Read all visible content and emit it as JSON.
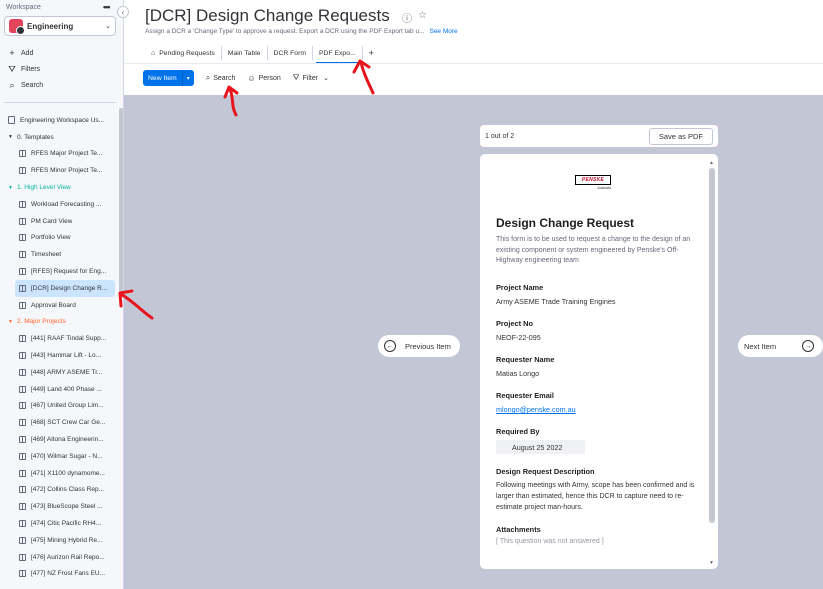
{
  "sidebar": {
    "workspace_label": "Workspace",
    "menu_dots": "•••",
    "workspace_name": "Engineering",
    "collapse_glyph": "‹",
    "actions": [
      {
        "icon": "+",
        "label": "Add"
      },
      {
        "icon": "⛛",
        "label": "Filters"
      },
      {
        "icon": "⌕",
        "label": "Search"
      }
    ],
    "tree": [
      {
        "kind": "doc",
        "level": 1,
        "label": "Engineering Workspace Us..."
      },
      {
        "kind": "folder",
        "level": 1,
        "label": "0. Templates",
        "color": "#323338"
      },
      {
        "kind": "board",
        "level": 2,
        "label": "RFES Major Project Te..."
      },
      {
        "kind": "board",
        "level": 2,
        "label": "RFES Minor Project Te..."
      },
      {
        "kind": "folder",
        "level": 1,
        "label": "1. High Level View",
        "color": "#00b3a4"
      },
      {
        "kind": "board",
        "level": 2,
        "label": "Workload Forecasting ..."
      },
      {
        "kind": "board",
        "level": 2,
        "label": "PM Card View"
      },
      {
        "kind": "board",
        "level": 2,
        "label": "Portfolio View"
      },
      {
        "kind": "board",
        "level": 2,
        "label": "Timesheet"
      },
      {
        "kind": "board",
        "level": 2,
        "label": "[RFES] Request for Eng..."
      },
      {
        "kind": "board",
        "level": 2,
        "label": "[DCR] Design Change R...",
        "active": true
      },
      {
        "kind": "board",
        "level": 2,
        "label": "Approval Board"
      },
      {
        "kind": "folder",
        "level": 1,
        "label": "2. Major Projects",
        "color": "#ff642e"
      },
      {
        "kind": "board",
        "level": 2,
        "label": "[441] RAAF Tindal Supp..."
      },
      {
        "kind": "board",
        "level": 2,
        "label": "[443] Hammar Lift - Lo..."
      },
      {
        "kind": "board",
        "level": 2,
        "label": "[448] ARMY ASEME Tr..."
      },
      {
        "kind": "board",
        "level": 2,
        "label": "[449] Land 400 Phase ..."
      },
      {
        "kind": "board",
        "level": 2,
        "label": "[467] United Group Lim..."
      },
      {
        "kind": "board",
        "level": 2,
        "label": "[468] SCT Crew Car Ge..."
      },
      {
        "kind": "board",
        "level": 2,
        "label": "[469] Altona Engineerin..."
      },
      {
        "kind": "board",
        "level": 2,
        "label": "[470] Wilmar Sugar - N..."
      },
      {
        "kind": "board",
        "level": 2,
        "label": "[471] X1100 dynamome..."
      },
      {
        "kind": "board",
        "level": 2,
        "label": "[472] Collins Class Rep..."
      },
      {
        "kind": "board",
        "level": 2,
        "label": "[473] BlueScope Steel ..."
      },
      {
        "kind": "board",
        "level": 2,
        "label": "[474] Citic Pacific RH4..."
      },
      {
        "kind": "board",
        "level": 2,
        "label": "[475] Mining Hybrid Re..."
      },
      {
        "kind": "board",
        "level": 2,
        "label": "[476] Aurizon Rail Repo..."
      },
      {
        "kind": "board",
        "level": 2,
        "label": "[477] NZ Frost Fans EU..."
      }
    ]
  },
  "header": {
    "title": "[DCR] Design Change Requests",
    "info_icon": "ⓘ",
    "star_icon": "☆",
    "description": "Assign a DCR a 'Change Type' to approve a request. Export a DCR using the PDF Export tab u...",
    "see_more": "See More",
    "tabs": [
      {
        "label": "Pending Requests",
        "icon": "⌂",
        "active": false
      },
      {
        "label": "Main Table",
        "active": false
      },
      {
        "label": "DCR Form",
        "active": false
      },
      {
        "label": "PDF Expo...",
        "active": true
      }
    ],
    "add_tab": "+"
  },
  "toolbar": {
    "new_item": "New Item",
    "dropdown": "▾",
    "search": "Search",
    "person": "Person",
    "filter": "Filter",
    "filter_chev": "⌄"
  },
  "viewer": {
    "pager_text": "1 out of 2",
    "save_pdf": "Save as PDF",
    "previous": "Previous Item",
    "next": "Next Item"
  },
  "form": {
    "logo_text": "PENSKE",
    "logo_sub": "Australia",
    "title": "Design Change Request",
    "intro": "This form is to be used to request a change to the design of an existing component or system engineered by Penske's Off-Highway engineering team",
    "project_name_label": "Project Name",
    "project_name": "Army ASEME Trade Training Engines",
    "project_no_label": "Project No",
    "project_no": "NEOF-22-095",
    "requester_name_label": "Requester Name",
    "requester_name": "Matias Longo",
    "requester_email_label": "Requester Email",
    "requester_email": "mlongo@penske.com.au",
    "required_by_label": "Required By",
    "required_by": "August 25 2022",
    "description_label": "Design Request Description",
    "description": "Following meetings with Army, scope has been confirmed and is larger than estimated, hence this DCR to capture need to re-estimate project man-hours.",
    "attachments_label": "Attachments",
    "attachments_value": "[ This question was not answered ]"
  },
  "colors": {
    "accent": "#0073ea",
    "annotation": "#e8141c",
    "canvas": "#c3c6d4"
  }
}
